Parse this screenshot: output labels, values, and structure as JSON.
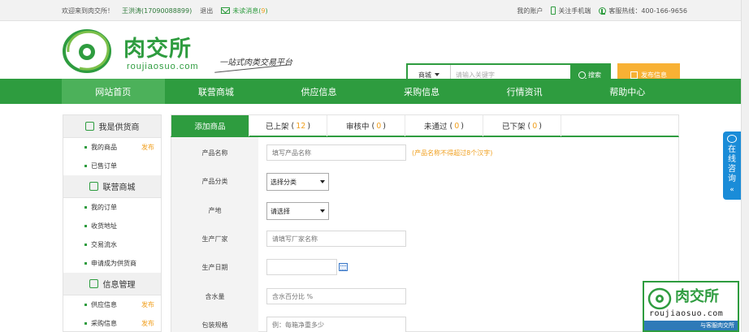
{
  "topbar": {
    "welcome": "欢迎来到肉交所！",
    "user": "王洪涛(17090088899)",
    "logout": "退出",
    "unread_label": "未读消息(",
    "unread_count": "9",
    "unread_suffix": ")",
    "account": "我的账户",
    "mobile": "关注手机端",
    "hotline": "客服热线：400-166-9656"
  },
  "header": {
    "logo_cn": "肉交所",
    "logo_en": "roujiaosuo.com",
    "slogan": "一站式肉类交易平台",
    "search": {
      "category": "商城",
      "placeholder": "请输入关键字",
      "button": "搜索"
    },
    "publish": "发布信息"
  },
  "nav": {
    "items": [
      "网站首页",
      "联营商城",
      "供应信息",
      "采购信息",
      "行情资讯",
      "帮助中心"
    ]
  },
  "sidebar": {
    "sections": [
      {
        "title": "我是供货商",
        "items": [
          {
            "label": "我的商品",
            "tag": "发布"
          },
          {
            "label": "已售订单"
          }
        ]
      },
      {
        "title": "联营商城",
        "items": [
          {
            "label": "我的订单"
          },
          {
            "label": "收货地址"
          },
          {
            "label": "交易流水"
          },
          {
            "label": "申请成为供货商"
          }
        ]
      },
      {
        "title": "信息管理",
        "items": [
          {
            "label": "供应信息",
            "tag": "发布"
          },
          {
            "label": "采购信息",
            "tag": "发布"
          }
        ]
      }
    ]
  },
  "tabs": [
    {
      "label": "添加商品"
    },
    {
      "label": "已上架",
      "count": "12"
    },
    {
      "label": "审核中",
      "count": "0"
    },
    {
      "label": "未通过",
      "count": "0"
    },
    {
      "label": "已下架",
      "count": "0"
    }
  ],
  "form": {
    "name": {
      "label": "产品名称",
      "placeholder": "填写产品名称",
      "hint": "(产品名称不得超过8个汉字)"
    },
    "category": {
      "label": "产品分类",
      "value": "选择分类"
    },
    "origin": {
      "label": "产地",
      "value": "请选择"
    },
    "maker": {
      "label": "生产厂家",
      "placeholder": "请填写厂家名称"
    },
    "date": {
      "label": "生产日期",
      "placeholder": ""
    },
    "water": {
      "label": "含水量",
      "placeholder": "含水百分比 %"
    },
    "pack": {
      "label": "包装规格",
      "placeholder": "例：每箱净重多少"
    }
  },
  "widgets": {
    "consult": [
      "在",
      "线",
      "咨",
      "询"
    ],
    "consult_arrow": "«",
    "ad_cn": "肉交所",
    "ad_en": "roujiaosuo.com",
    "ad_bar": "与客服肉交所"
  },
  "colors": {
    "brand": "#2e9c3f",
    "accent": "#f8b134",
    "consult": "#1a8cd8"
  }
}
